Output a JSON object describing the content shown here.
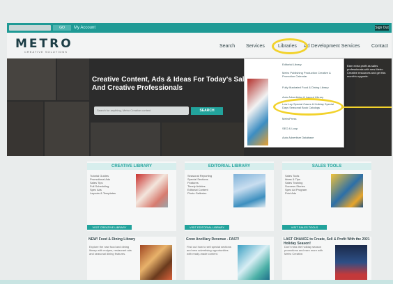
{
  "utility_bar": {
    "search_placeholder": "Search...",
    "go_label": "GO",
    "account_text": "My Account",
    "right_button": "Sign Out"
  },
  "header": {
    "logo": "METRO",
    "tagline": "CREATIVE SOLUTIONS",
    "nav": [
      "Search",
      "Services",
      "Libraries",
      "Ad Development Services",
      "Contact"
    ]
  },
  "hero": {
    "title": "Creative Content, Ads & Ideas For Today's Sales And Creative Professionals",
    "search_placeholder": "Search for anything, Metro Creative content",
    "search_button": "SEARCH"
  },
  "dropdown": {
    "items": [
      "Editorial Library",
      "Metro Publishing Production Creative & Promotion Calendar",
      "Fully Illustrated Food & Dining Library",
      "Auto Advertising & Layout Library",
      "Low Lay Special Cases & Holiday Special Days Seasonal Book Catalogs",
      "MetroPress",
      "SEO & Loop",
      "Auto Advertiser Database"
    ],
    "side_text": "Earn extra profit as sales professionals with new Metro Creative resources and get this month's upgrade."
  },
  "panels": [
    {
      "head": "CREATIVE LIBRARY",
      "bullets": [
        "Tutorial Guides",
        "Promotional Ads",
        "Sales Tips",
        "Full Scheduling",
        "Spec Ads",
        "Layouts & Templates"
      ],
      "button": "VISIT CREATIVE LIBRARY"
    },
    {
      "head": "EDITORIAL LIBRARY",
      "bullets": [
        "Seasonal Reporting",
        "Special Sections",
        "Features",
        "Timely Articles",
        "Editorial Content",
        "Photo Galleries"
      ],
      "button": "VISIT EDITORIAL LIBRARY"
    },
    {
      "head": "SALES TOOLS",
      "bullets": [
        "Sales Tools",
        "Ideas & Tips",
        "Sales Training",
        "Success Stories",
        "Spec Ad Program",
        "Print Ads"
      ],
      "button": "VISIT SALES TOOLS"
    }
  ],
  "cards": [
    {
      "title": "NEW! Food & Dining Library",
      "text": "Explore the new food and dining library with recipes, restaurant ads and seasonal dining features."
    },
    {
      "title": "Grow Ancillary Revenue - FAST!",
      "text": "Find out how to sell special sections and new advertising opportunities with ready-made content."
    },
    {
      "title": "LAST CHANCE to Create, Sell & Profit With the 2021 Holiday Season!",
      "text": "Don't miss the holiday season promotions and earn more with Metro Creative."
    }
  ],
  "colors": {
    "teal": "#22a39c",
    "highlight_circle": "#f2d22c",
    "logo": "#1d3e46"
  }
}
